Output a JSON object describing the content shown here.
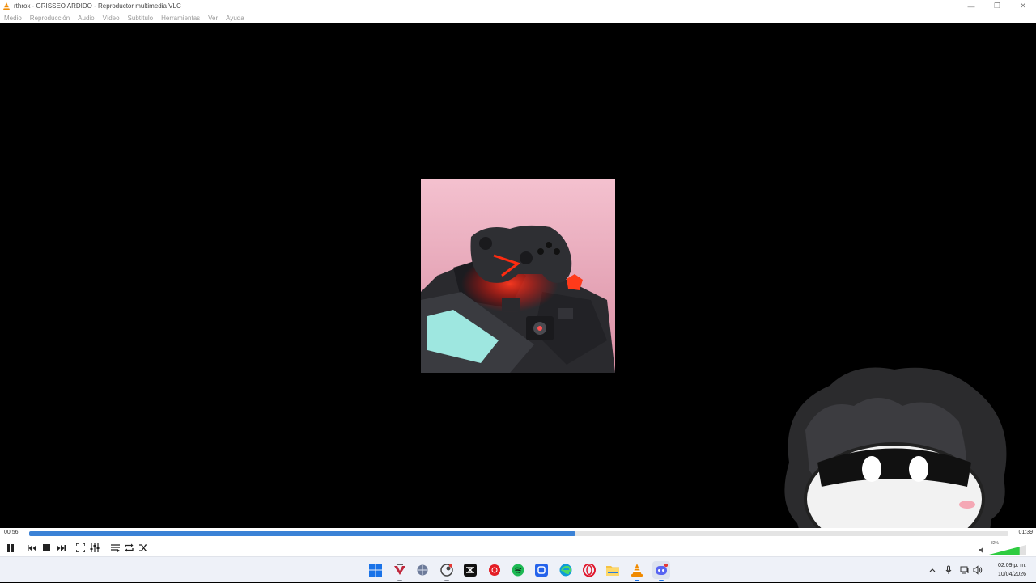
{
  "window": {
    "title": "rthrox - GRISSEO ARDIDO - Reproductor multimedia VLC"
  },
  "menubar": {
    "items": [
      "Medio",
      "Reproducción",
      "Audio",
      "Vídeo",
      "Subtítulo",
      "Herramientas",
      "Ver",
      "Ayuda"
    ]
  },
  "playback": {
    "elapsed": "00:56",
    "total": "01:39",
    "progress_fraction": 0.558
  },
  "controls": {
    "icons": [
      "pause-icon",
      "previous-icon",
      "stop-icon",
      "next-icon",
      "fullscreen-icon",
      "equalizer-icon",
      "playlist-icon",
      "loop-icon",
      "shuffle-icon"
    ]
  },
  "volume": {
    "percent_label": "82%",
    "level_fraction": 0.82
  },
  "taskbar": {
    "apps": [
      "windows-start-icon",
      "app-v-icon",
      "app-globe-icon",
      "app-steam-icon",
      "capcut-icon",
      "youtube-music-icon",
      "spotify-icon",
      "app-blue-icon",
      "edge-icon",
      "opera-icon",
      "file-explorer-icon",
      "vlc-icon",
      "discord-icon"
    ]
  },
  "clock": {
    "time": "02:09 p. m.",
    "date": "10/04/2026"
  },
  "colors": {
    "seek_fill": "#3b82d6",
    "album_bg": "#f2b6c6",
    "vlc_orange": "#f08a00"
  }
}
